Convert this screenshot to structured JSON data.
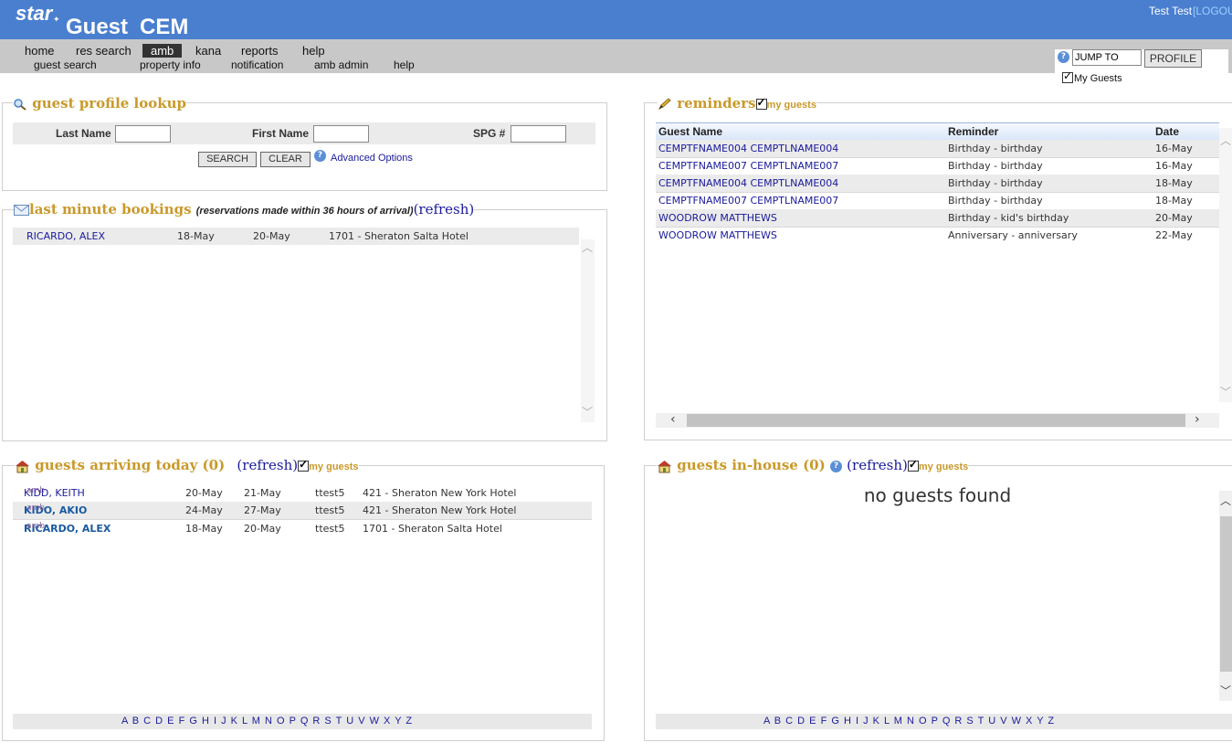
{
  "header": {
    "logo_star": "star",
    "logo_guest": "Guest",
    "logo_cem": "CEM",
    "user": "Test Test",
    "logout": "[LOGOUT"
  },
  "nav": {
    "top": [
      "home",
      "res search",
      "amb",
      "kana",
      "reports",
      "help"
    ],
    "active": "amb",
    "sub": [
      "guest search",
      "property info",
      "notification",
      "amb admin",
      "help"
    ]
  },
  "jump": {
    "input_value": "JUMP TO",
    "profile_button": "PROFILE",
    "my_guests_label": "My Guests"
  },
  "lookup": {
    "title": "guest profile lookup",
    "last_name_label": "Last Name",
    "first_name_label": "First Name",
    "spg_label": "SPG #",
    "search_button": "SEARCH",
    "clear_button": "CLEAR",
    "advanced_options": "Advanced Options"
  },
  "last_minute": {
    "title": "last minute bookings",
    "subtitle": "(reservations made within 36 hours of arrival)",
    "refresh": "(refresh)",
    "rows": [
      {
        "name": "RICARDO, ALEX",
        "arrive": "18-May",
        "depart": "20-May",
        "hotel": "1701 - Sheraton Salta Hotel"
      }
    ]
  },
  "reminders": {
    "title": "reminders",
    "my_guests": "my guests",
    "headers": [
      "Guest Name",
      "Reminder",
      "Date"
    ],
    "rows": [
      {
        "name": "CEMPTFNAME004 CEMPTLNAME004",
        "reminder": "Birthday - birthday",
        "date": "16-May"
      },
      {
        "name": "CEMPTFNAME007 CEMPTLNAME007",
        "reminder": "Birthday - birthday",
        "date": "16-May"
      },
      {
        "name": "CEMPTFNAME004 CEMPTLNAME004",
        "reminder": "Birthday - birthday",
        "date": "18-May"
      },
      {
        "name": "CEMPTFNAME007 CEMPTLNAME007",
        "reminder": "Birthday - birthday",
        "date": "18-May"
      },
      {
        "name": "WOODROW MATTHEWS",
        "reminder": "Birthday - kid's birthday",
        "date": "20-May"
      },
      {
        "name": "WOODROW MATTHEWS",
        "reminder": "Anniversary - anniversary",
        "date": "22-May"
      }
    ]
  },
  "arriving": {
    "title": "guests arriving today (0)",
    "refresh": "(refresh)",
    "my_guests": "my guests",
    "rows": [
      {
        "name": "KIDD, KEITH",
        "tag": "amb",
        "arrive": "20-May",
        "depart": "21-May",
        "user": "ttest5",
        "hotel": "421 - Sheraton New York Hotel",
        "bold": false
      },
      {
        "name": "KIDO, AKIO",
        "tag": "amb",
        "arrive": "24-May",
        "depart": "27-May",
        "user": "ttest5",
        "hotel": "421 - Sheraton New York Hotel",
        "bold": true
      },
      {
        "name": "RICARDO, ALEX",
        "tag": "amb",
        "arrive": "18-May",
        "depart": "20-May",
        "user": "ttest5",
        "hotel": "1701 - Sheraton Salta Hotel",
        "bold": true
      }
    ],
    "alphabet": "A B C D E F G H I J K L M N O P Q R S T U V W X Y Z"
  },
  "inhouse": {
    "title": "guests in-house (0)",
    "refresh": "(refresh)",
    "my_guests": "my guests",
    "empty_message": "no guests found",
    "alphabet": "A B C D E F G H I J K L M N O P Q R S T U V W X Y Z"
  }
}
